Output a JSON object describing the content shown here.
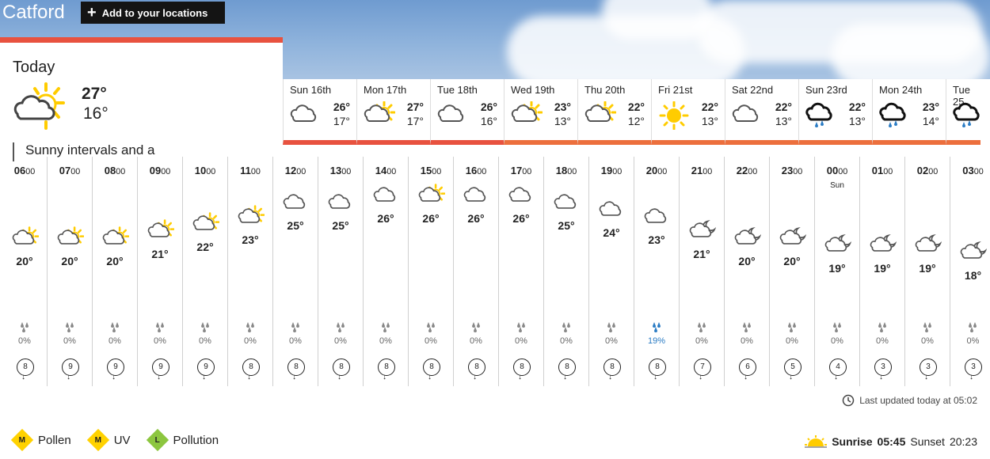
{
  "location": {
    "name": "Catford",
    "add_label": "Add to your locations"
  },
  "today": {
    "title": "Today",
    "max": "27°",
    "min": "16°",
    "icon": "sunny-intervals-icon",
    "description": "Sunny intervals and a"
  },
  "days": [
    {
      "name": "Sun 16th",
      "max": "26°",
      "min": "17°",
      "icon": "cloud-icon"
    },
    {
      "name": "Mon 17th",
      "max": "27°",
      "min": "17°",
      "icon": "sunny-intervals-icon"
    },
    {
      "name": "Tue 18th",
      "max": "26°",
      "min": "16°",
      "icon": "cloud-icon"
    },
    {
      "name": "Wed 19th",
      "max": "23°",
      "min": "13°",
      "icon": "sunny-intervals-icon"
    },
    {
      "name": "Thu 20th",
      "max": "22°",
      "min": "12°",
      "icon": "sunny-intervals-icon"
    },
    {
      "name": "Fri 21st",
      "max": "22°",
      "min": "13°",
      "icon": "sun-icon"
    },
    {
      "name": "Sat 22nd",
      "max": "22°",
      "min": "13°",
      "icon": "cloud-icon"
    },
    {
      "name": "Sun 23rd",
      "max": "22°",
      "min": "13°",
      "icon": "rain-cloud-icon"
    },
    {
      "name": "Mon 24th",
      "max": "23°",
      "min": "14°",
      "icon": "rain-cloud-icon"
    },
    {
      "name": "Tue 25",
      "max": "",
      "min": "",
      "icon": "rain-cloud-icon"
    }
  ],
  "hours": [
    {
      "time": "06",
      "min": "00",
      "temp": "20°",
      "temp_value": 20,
      "icon": "sunny-intervals-icon",
      "rain": "0%",
      "wind": "8"
    },
    {
      "time": "07",
      "min": "00",
      "temp": "20°",
      "temp_value": 20,
      "icon": "sunny-intervals-icon",
      "rain": "0%",
      "wind": "9"
    },
    {
      "time": "08",
      "min": "00",
      "temp": "20°",
      "temp_value": 20,
      "icon": "sunny-intervals-icon",
      "rain": "0%",
      "wind": "9"
    },
    {
      "time": "09",
      "min": "00",
      "temp": "21°",
      "temp_value": 21,
      "icon": "sunny-intervals-icon",
      "rain": "0%",
      "wind": "9"
    },
    {
      "time": "10",
      "min": "00",
      "temp": "22°",
      "temp_value": 22,
      "icon": "sunny-intervals-icon",
      "rain": "0%",
      "wind": "9"
    },
    {
      "time": "11",
      "min": "00",
      "temp": "23°",
      "temp_value": 23,
      "icon": "sunny-intervals-icon",
      "rain": "0%",
      "wind": "8"
    },
    {
      "time": "12",
      "min": "00",
      "temp": "25°",
      "temp_value": 25,
      "icon": "cloud-icon",
      "rain": "0%",
      "wind": "8"
    },
    {
      "time": "13",
      "min": "00",
      "temp": "25°",
      "temp_value": 25,
      "icon": "cloud-icon",
      "rain": "0%",
      "wind": "8"
    },
    {
      "time": "14",
      "min": "00",
      "temp": "26°",
      "temp_value": 26,
      "icon": "cloud-icon",
      "rain": "0%",
      "wind": "8"
    },
    {
      "time": "15",
      "min": "00",
      "temp": "26°",
      "temp_value": 26,
      "icon": "sunny-intervals-icon",
      "rain": "0%",
      "wind": "8"
    },
    {
      "time": "16",
      "min": "00",
      "temp": "26°",
      "temp_value": 26,
      "icon": "cloud-icon",
      "rain": "0%",
      "wind": "8"
    },
    {
      "time": "17",
      "min": "00",
      "temp": "26°",
      "temp_value": 26,
      "icon": "cloud-icon",
      "rain": "0%",
      "wind": "8"
    },
    {
      "time": "18",
      "min": "00",
      "temp": "25°",
      "temp_value": 25,
      "icon": "cloud-icon",
      "rain": "0%",
      "wind": "8"
    },
    {
      "time": "19",
      "min": "00",
      "temp": "24°",
      "temp_value": 24,
      "icon": "cloud-icon",
      "rain": "0%",
      "wind": "8"
    },
    {
      "time": "20",
      "min": "00",
      "temp": "23°",
      "temp_value": 23,
      "icon": "cloud-icon",
      "rain": "19%",
      "wind": "8"
    },
    {
      "time": "21",
      "min": "00",
      "temp": "21°",
      "temp_value": 21,
      "icon": "cloud-moon-icon",
      "rain": "0%",
      "wind": "7"
    },
    {
      "time": "22",
      "min": "00",
      "temp": "20°",
      "temp_value": 20,
      "icon": "cloud-moon-icon",
      "rain": "0%",
      "wind": "6"
    },
    {
      "time": "23",
      "min": "00",
      "temp": "20°",
      "temp_value": 20,
      "icon": "cloud-moon-icon",
      "rain": "0%",
      "wind": "5"
    },
    {
      "time": "00",
      "min": "00",
      "sub": "Sun",
      "temp": "19°",
      "temp_value": 19,
      "icon": "cloud-moon-icon",
      "rain": "0%",
      "wind": "4"
    },
    {
      "time": "01",
      "min": "00",
      "temp": "19°",
      "temp_value": 19,
      "icon": "cloud-moon-icon",
      "rain": "0%",
      "wind": "3"
    },
    {
      "time": "02",
      "min": "00",
      "temp": "19°",
      "temp_value": 19,
      "icon": "cloud-moon-icon",
      "rain": "0%",
      "wind": "3"
    },
    {
      "time": "03",
      "min": "00",
      "temp": "18°",
      "temp_value": 18,
      "icon": "cloud-moon-icon",
      "rain": "0%",
      "wind": "3"
    }
  ],
  "updated": "Last updated today at 05:02",
  "badges": [
    {
      "letter": "M",
      "label": "Pollen",
      "color": "#ffd200"
    },
    {
      "letter": "M",
      "label": "UV",
      "color": "#ffd200"
    },
    {
      "letter": "L",
      "label": "Pollution",
      "color": "#8cc63f"
    }
  ],
  "sun": {
    "sunrise_label": "Sunrise",
    "sunrise": "05:45",
    "sunset_label": "Sunset",
    "sunset": "20:23"
  },
  "colors": {
    "today_accent": "#e8523f",
    "day_bar": "#ec6f3d",
    "rain": "#2b7cc4",
    "sun": "#ffcc00"
  }
}
